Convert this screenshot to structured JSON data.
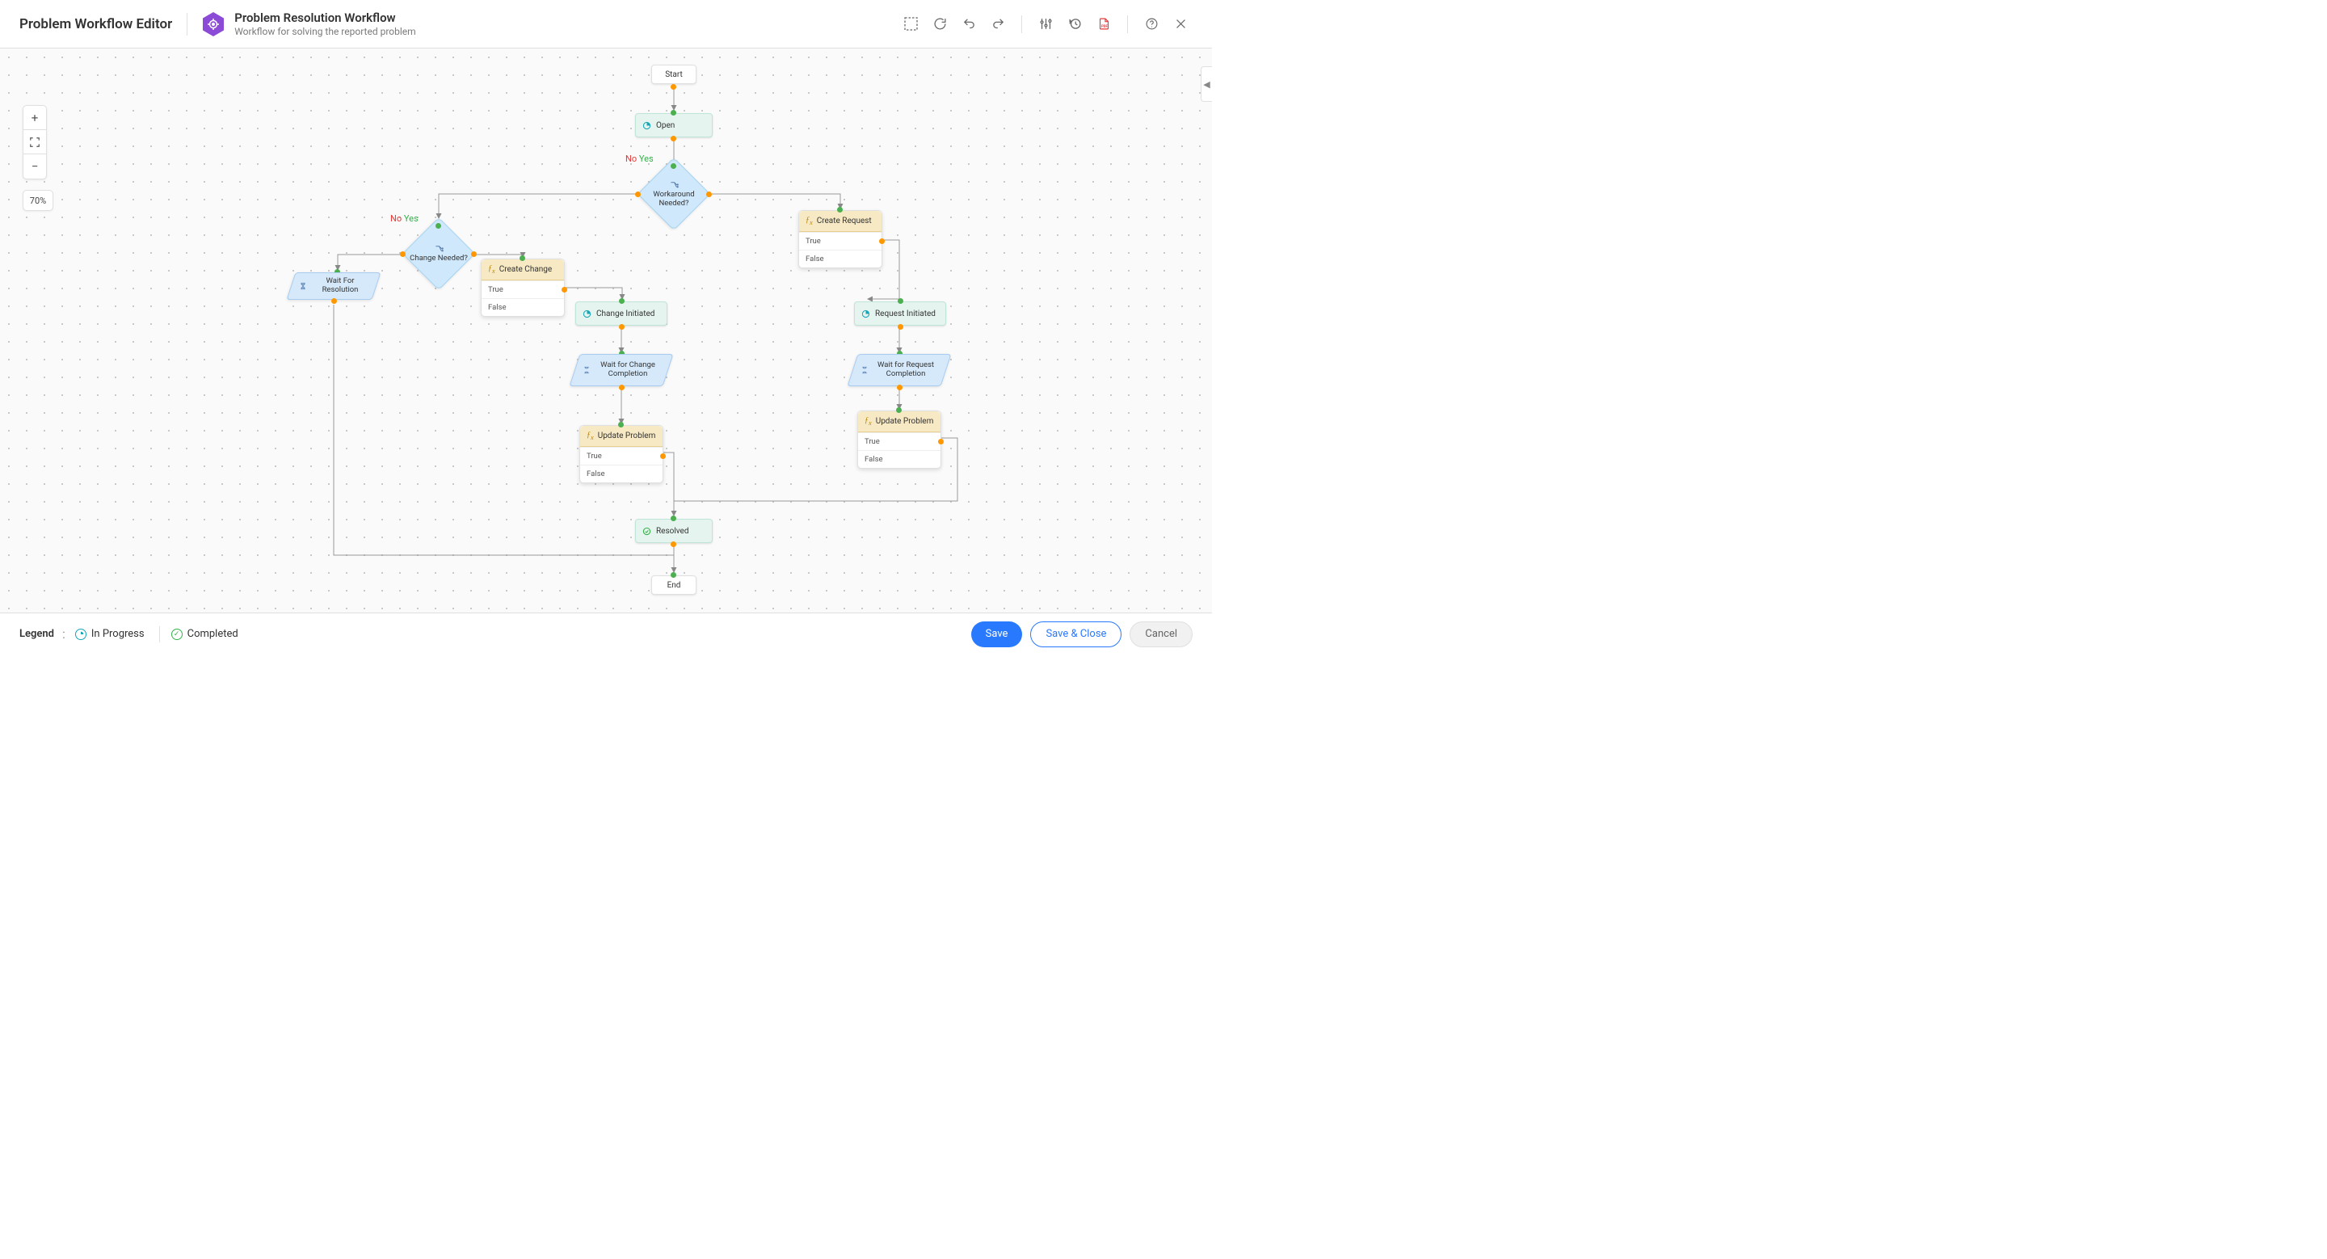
{
  "header": {
    "app_title": "Problem Workflow Editor",
    "workflow_title": "Problem Resolution Workflow",
    "workflow_subtitle": "Workflow for solving the reported problem"
  },
  "zoom": {
    "level": "70%"
  },
  "legend": {
    "label": "Legend",
    "in_progress": "In Progress",
    "completed": "Completed"
  },
  "footer": {
    "save": "Save",
    "save_close": "Save & Close",
    "cancel": "Cancel"
  },
  "nodes": {
    "start": "Start",
    "open": "Open",
    "workaround": "Workaround Needed?",
    "change_needed": "Change Needed?",
    "create_request": "Create Request",
    "create_change": "Create Change",
    "request_initiated": "Request Initiated",
    "change_initiated": "Change Initiated",
    "wait_request": "Wait for Request Completion",
    "wait_change": "Wait for Change Completion",
    "wait_resolution": "Wait For Resolution",
    "update_problem": "Update Problem",
    "resolved": "Resolved",
    "end": "End",
    "opt_true": "True",
    "opt_false": "False",
    "yes": "Yes",
    "no": "No"
  }
}
